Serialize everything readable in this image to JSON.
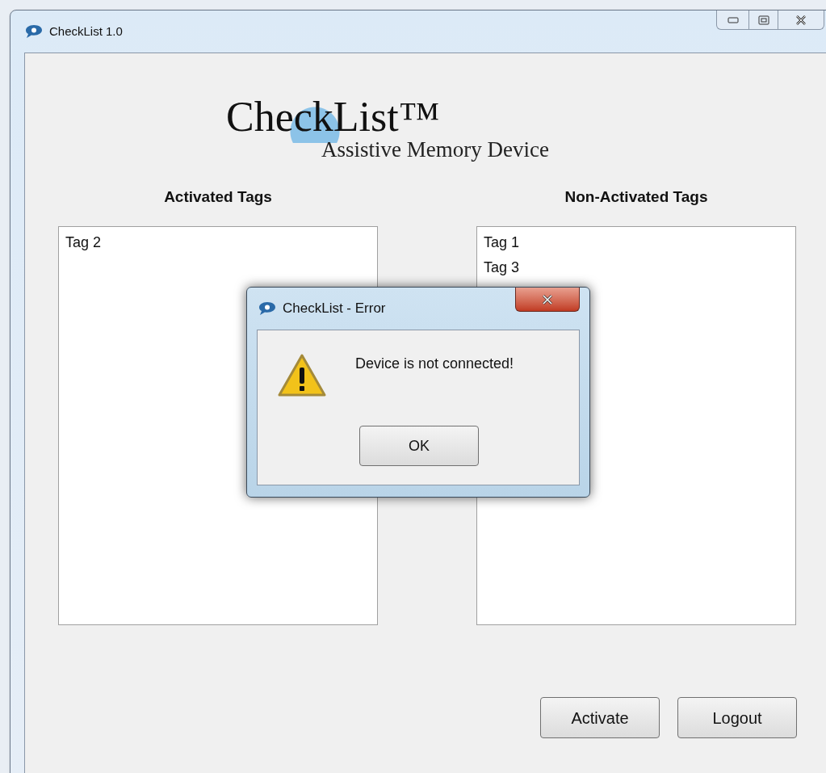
{
  "window": {
    "title": "CheckList 1.0"
  },
  "logo": {
    "title": "CheckList™",
    "subtitle": "Assistive Memory Device"
  },
  "lists": [
    {
      "heading": "Activated Tags",
      "items": [
        "Tag 2"
      ]
    },
    {
      "heading": "Non-Activated Tags",
      "items": [
        "Tag 1",
        "Tag 3"
      ]
    }
  ],
  "buttons": [
    "Activate",
    "Logout"
  ],
  "dialog": {
    "title": "CheckList - Error",
    "message": "Device is not connected!",
    "button": "OK"
  }
}
